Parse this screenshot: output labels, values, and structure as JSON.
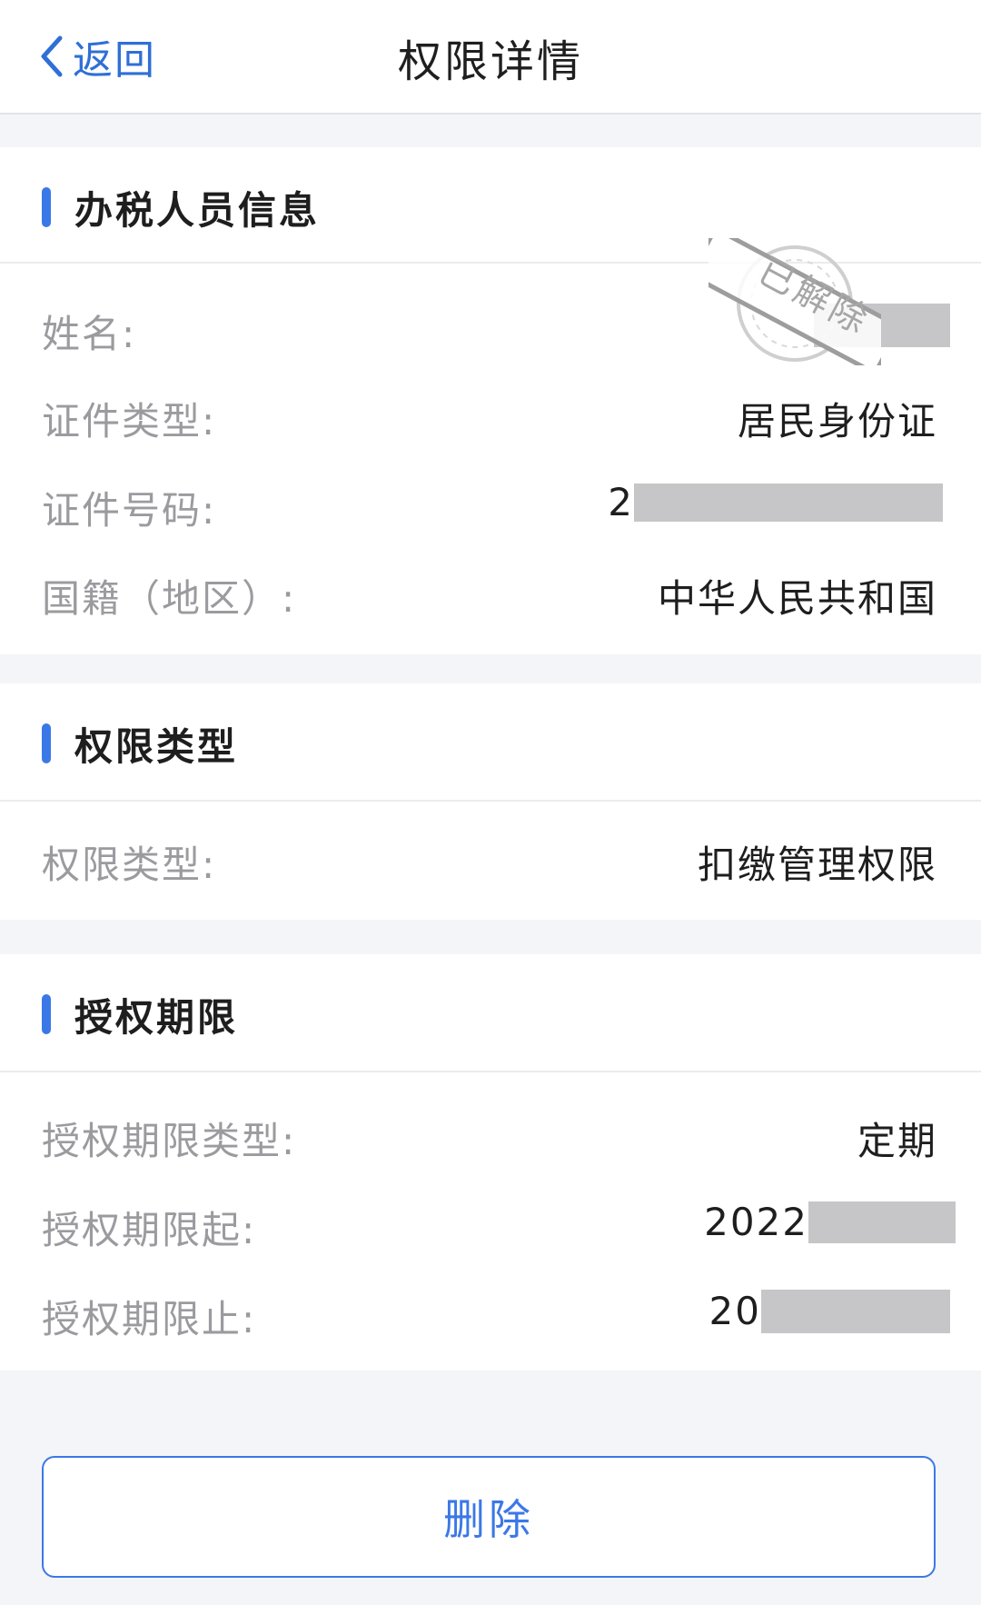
{
  "header": {
    "back_label": "返回",
    "title": "权限详情"
  },
  "sections": [
    {
      "title": "办税人员信息",
      "rows": [
        {
          "label": "姓名:",
          "value": ""
        },
        {
          "label": "证件类型:",
          "value": "居民身份证"
        },
        {
          "label": "证件号码:",
          "value": "2"
        },
        {
          "label": "国籍（地区）:",
          "value": "中华人民共和国"
        }
      ]
    },
    {
      "title": "权限类型",
      "rows": [
        {
          "label": "权限类型:",
          "value": "扣缴管理权限"
        }
      ]
    },
    {
      "title": "授权期限",
      "rows": [
        {
          "label": "授权期限类型:",
          "value": "定期"
        },
        {
          "label": "授权期限起:",
          "value": "2022"
        },
        {
          "label": "授权期限止:",
          "value": "20"
        }
      ]
    }
  ],
  "stamp_text": "已解除",
  "delete_label": "删除",
  "colors": {
    "accent": "#3b78e7",
    "background": "#f4f5f8",
    "label": "#9b9b9f",
    "value": "#1e1e1e"
  }
}
